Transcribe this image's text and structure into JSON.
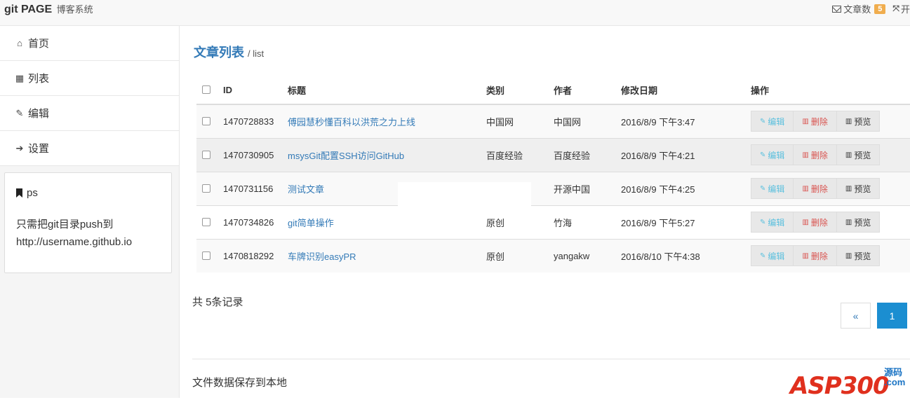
{
  "header": {
    "brand": "git PAGE",
    "brand_sub": "博客系统",
    "article_count_label": "文章数",
    "article_count": "5",
    "right_partial": "开"
  },
  "sidebar": {
    "items": [
      {
        "label": "首页",
        "icon": "home-icon"
      },
      {
        "label": "列表",
        "icon": "table-icon"
      },
      {
        "label": "编辑",
        "icon": "edit-icon"
      },
      {
        "label": "设置",
        "icon": "sign-in-icon"
      }
    ],
    "ps_title": "ps",
    "ps_text": "只需把git目录push到 http://username.github.io"
  },
  "main": {
    "title": "文章列表",
    "subtitle": "/ list",
    "columns": [
      "ID",
      "标题",
      "类别",
      "作者",
      "修改日期",
      "操作"
    ],
    "rows": [
      {
        "id": "1470728833",
        "title": "傅园慧秒懂百科以洪荒之力上线",
        "category": "中国网",
        "author": "中国网",
        "date": "2016/8/9 下午3:47"
      },
      {
        "id": "1470730905",
        "title": "msysGit配置SSH访问GitHub",
        "category": "百度经验",
        "author": "百度经验",
        "date": "2016/8/9 下午4:21"
      },
      {
        "id": "1470731156",
        "title": "测试文章",
        "category": "",
        "author": "开源中国",
        "date": "2016/8/9 下午4:25"
      },
      {
        "id": "1470734826",
        "title": "git简单操作",
        "category": "原创",
        "author": "竹海",
        "date": "2016/8/9 下午5:27"
      },
      {
        "id": "1470818292",
        "title": "车牌识别easyPR",
        "category": "原创",
        "author": "yangakw",
        "date": "2016/8/10 下午4:38"
      }
    ],
    "actions": {
      "edit": "编辑",
      "delete": "删除",
      "preview": "预览"
    },
    "total": "共 5条记录",
    "pager": {
      "prev": "«",
      "current": "1"
    },
    "footer": "文件数据保存到本地"
  },
  "watermark": {
    "text": "ASP300",
    "side_top": "源码",
    "side_bottom": ".com"
  },
  "colors": {
    "accent": "#337ab7",
    "badge": "#f0ad4e",
    "page_active": "#1b8ed1",
    "delete": "#d9534f",
    "edit": "#5bc0de"
  }
}
